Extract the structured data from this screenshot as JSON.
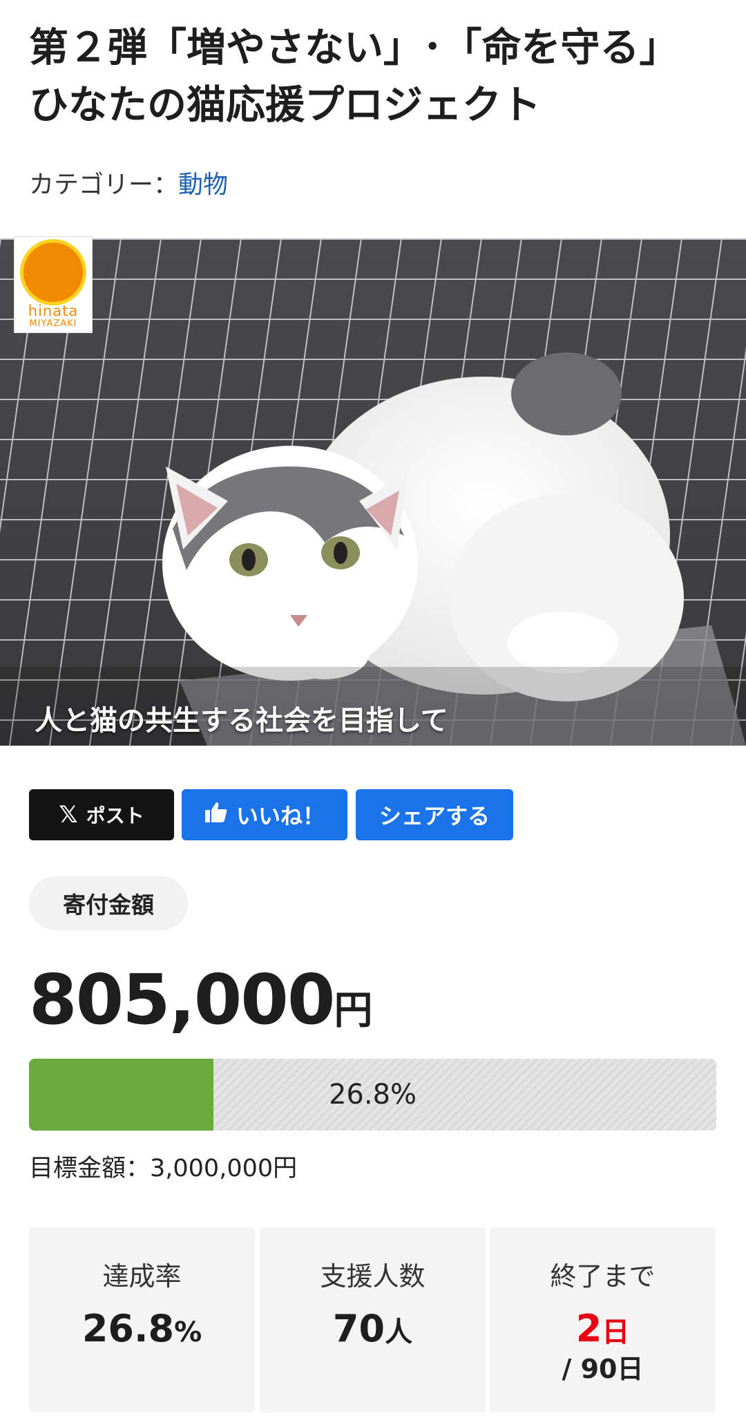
{
  "project": {
    "title": "第２弾「増やさない」･「命を守る」ひなたの猫応援プロジェクト",
    "category_label": "カテゴリー：",
    "category_value": "動物"
  },
  "hero": {
    "logo_text": "hinata",
    "logo_subtext": "MIYAZAKI",
    "caption": "人と猫の共生する社会を目指して"
  },
  "share": {
    "post_label": "ポスト",
    "like_label": "いいね！",
    "share_label": "シェアする"
  },
  "donation": {
    "pill_label": "寄付金額",
    "amount": "805,000",
    "unit": "円",
    "progress_percent": 26.8,
    "progress_text": "26.8%",
    "goal_text": "目標金額：3,000,000円"
  },
  "stats": {
    "rate_label": "達成率",
    "rate_value": "26.8",
    "rate_unit": "%",
    "supporters_label": "支援人数",
    "supporters_value": "70",
    "supporters_unit": "人",
    "remaining_label": "終了まで",
    "remaining_value": "2",
    "remaining_unit": "日",
    "total_days": "/ 90日"
  },
  "colors": {
    "accent_blue": "#1a73e8",
    "progress_green": "#6aaa3e",
    "alert_red": "#e60012",
    "link_blue": "#1f62b5"
  }
}
